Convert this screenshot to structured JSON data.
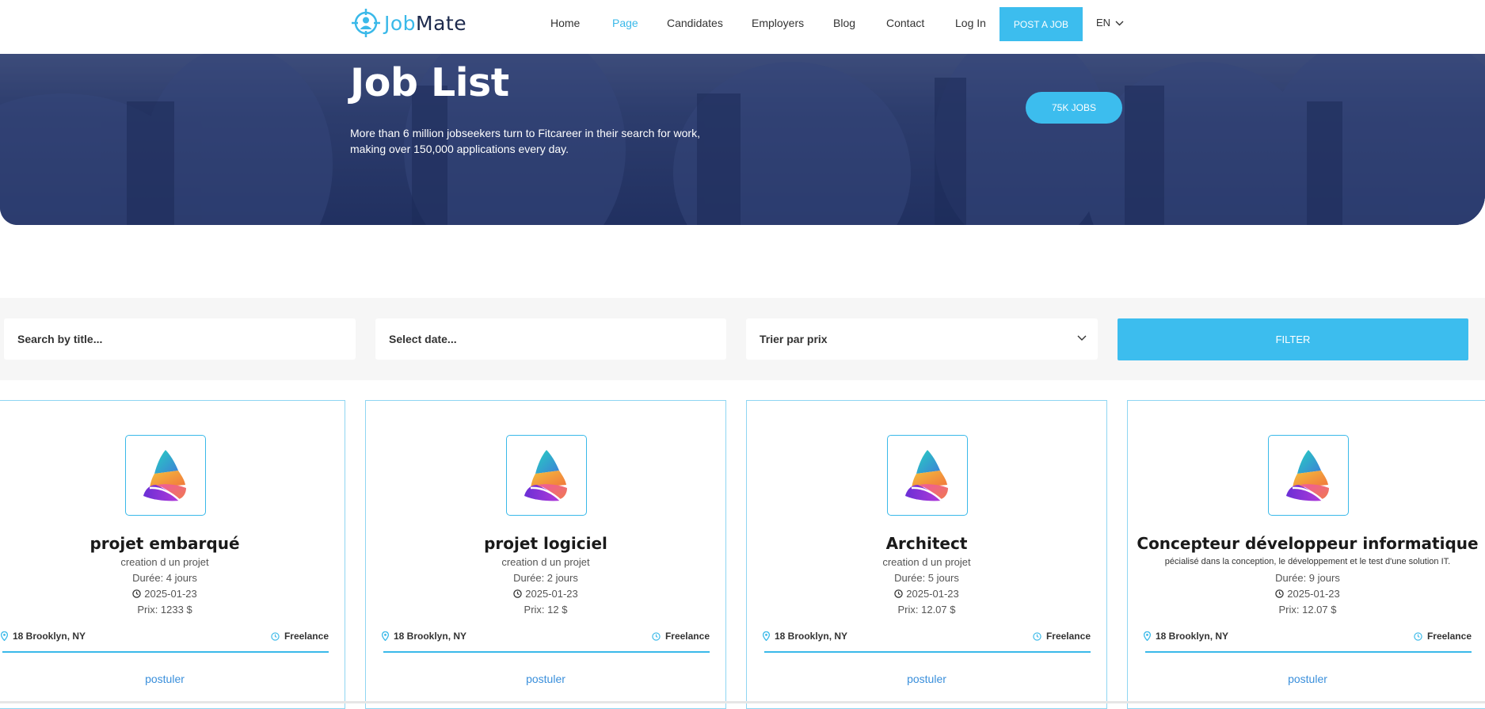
{
  "brand": {
    "part1": "Job",
    "part2": "Mate",
    "accent": "#3ab9e9"
  },
  "nav": {
    "items": [
      {
        "label": "Home"
      },
      {
        "label": "Page"
      },
      {
        "label": "Candidates"
      },
      {
        "label": "Employers"
      },
      {
        "label": "Blog"
      },
      {
        "label": "Contact"
      },
      {
        "label": "Log In"
      }
    ],
    "active": "Page",
    "post_job": "POST A JOB",
    "language": "EN"
  },
  "hero": {
    "title": "Job List",
    "subtitle": "More than 6 million jobseekers turn to Fitcareer in their search for work, making over 150,000 applications every day.",
    "jobs_pill": "75K JOBS"
  },
  "filters": {
    "title_search": "Search by title...",
    "date_select": "Select date...",
    "price_sort": "Trier par prix",
    "filter_button": "FILTER"
  },
  "jobs": [
    {
      "title": "projet embarqué",
      "description": "creation d un projet",
      "duration": "Durée: 4 jours",
      "date": "2025-01-23",
      "price": "Prix: 1233 $",
      "location": "18 Brooklyn, NY",
      "type": "Freelance",
      "action": "postuler"
    },
    {
      "title": "projet logiciel",
      "description": "creation d un projet",
      "duration": "Durée: 2 jours",
      "date": "2025-01-23",
      "price": "Prix: 12 $",
      "location": "18 Brooklyn, NY",
      "type": "Freelance",
      "action": "postuler"
    },
    {
      "title": "Architect",
      "description": "creation d un projet",
      "duration": "Durée: 5 jours",
      "date": "2025-01-23",
      "price": "Prix: 12.07 $",
      "location": "18 Brooklyn, NY",
      "type": "Freelance",
      "action": "postuler"
    },
    {
      "title": "Concepteur développeur informatique",
      "description": "pécialisé dans la conception, le développement et le test d'une solution IT.",
      "duration": "Durée: 9 jours",
      "date": "2025-01-23",
      "price": "Prix: 12.07 $",
      "location": "18 Brooklyn, NY",
      "type": "Freelance",
      "action": "postuler"
    }
  ]
}
